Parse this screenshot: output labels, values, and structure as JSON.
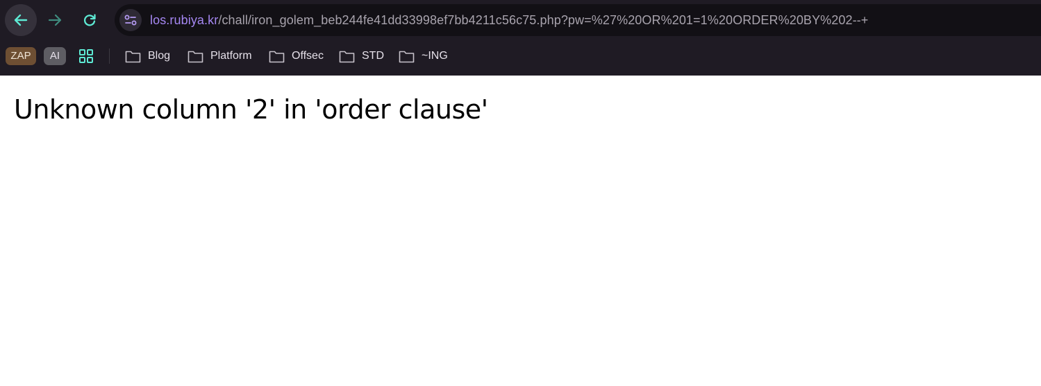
{
  "browser": {
    "url_host": "los.rubiya.kr",
    "url_path": "/chall/iron_golem_beb244fe41dd33998ef7bb4211c56c75.php?pw=%27%20OR%201=1%20ORDER%20BY%202--+",
    "icons": {
      "back": "arrow-left-icon",
      "forward": "arrow-right-icon",
      "reload": "reload-icon",
      "site_info": "tune-icon"
    },
    "accent_color": "#5eead4"
  },
  "bookmarks": {
    "chips": [
      "ZAP",
      "AI"
    ],
    "folders": [
      "Blog",
      "Platform",
      "Offsec",
      "STD",
      "~ING"
    ]
  },
  "page": {
    "error_message": "Unknown column '2' in 'order clause'"
  }
}
